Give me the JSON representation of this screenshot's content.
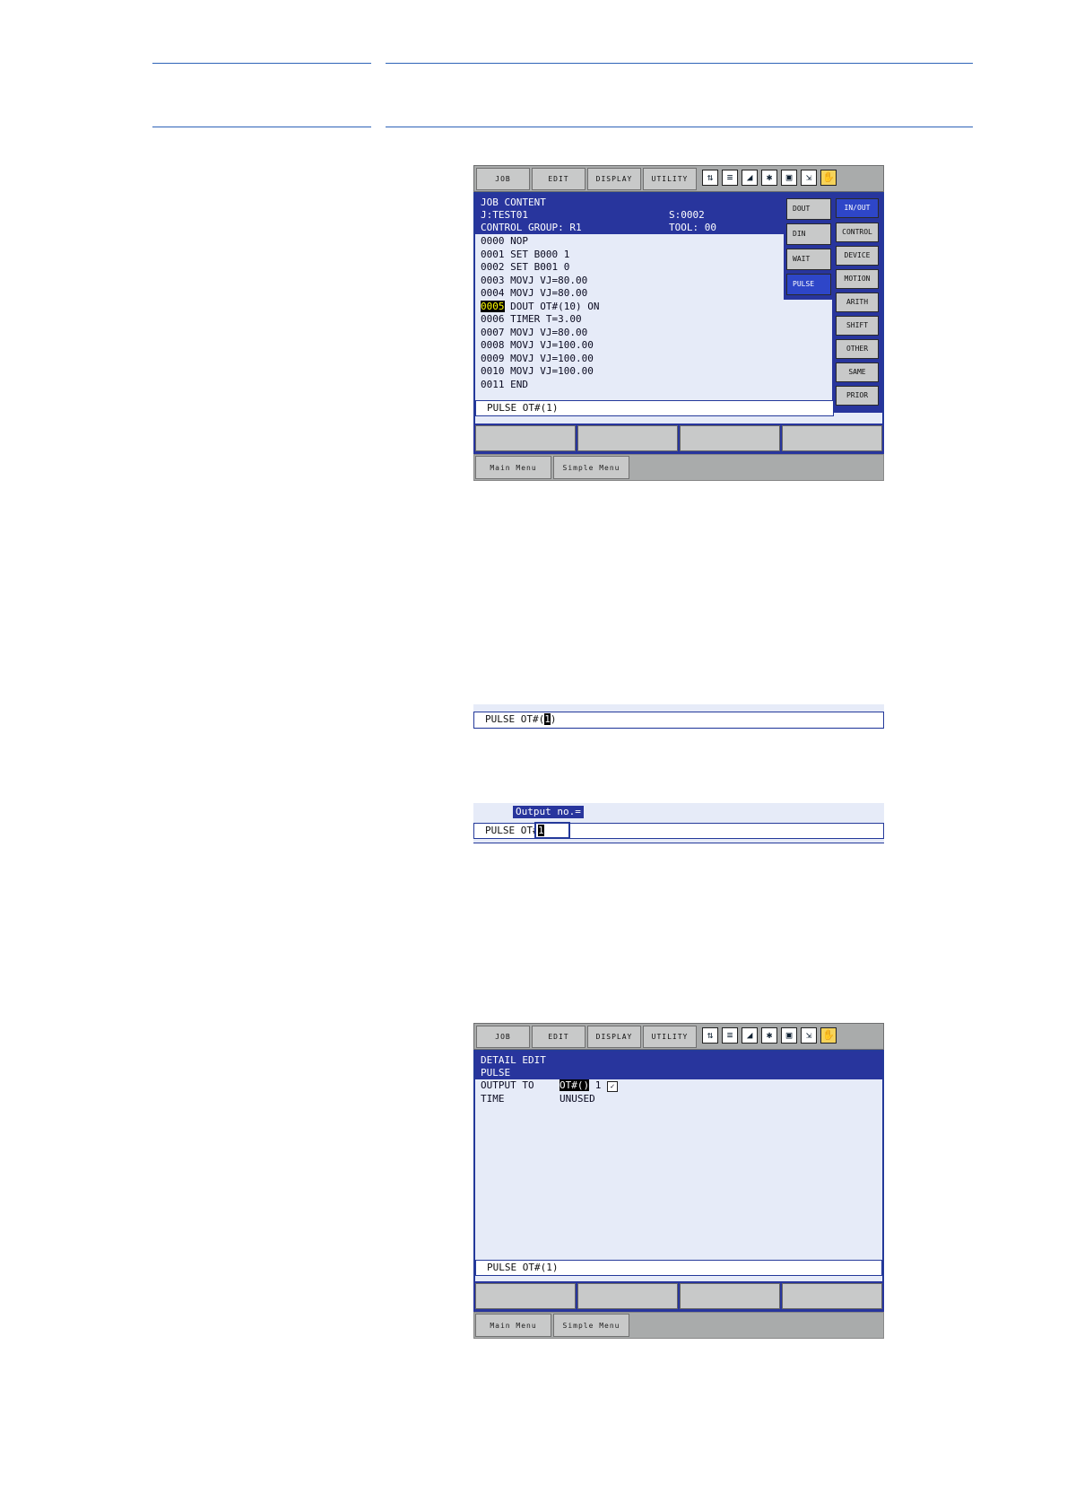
{
  "menu": {
    "job": "JOB",
    "edit": "EDIT",
    "display": "DISPLAY",
    "utility": "UTILITY"
  },
  "status_icons": [
    "hold-icon",
    "teach-icon",
    "signal-icon",
    "robot-icon",
    "page-icon",
    "storage-icon",
    "hand-icon"
  ],
  "bottom_menu": {
    "main": "Main Menu",
    "simple": "Simple Menu"
  },
  "screen1": {
    "title": "JOB CONTENT",
    "job": "J:TEST01",
    "step": "S:0002",
    "group": "CONTROL GROUP: R1",
    "tool": "TOOL: 00",
    "lines": [
      {
        "no": "0000",
        "text": "NOP"
      },
      {
        "no": "0001",
        "text": "SET B000 1"
      },
      {
        "no": "0002",
        "text": "SET B001 0"
      },
      {
        "no": "0003",
        "text": "MOVJ VJ=80.00"
      },
      {
        "no": "0004",
        "text": "MOVJ VJ=80.00"
      },
      {
        "no": "0005",
        "text": "DOUT OT#(10) ON",
        "cursor": true
      },
      {
        "no": "0006",
        "text": "TIMER T=3.00"
      },
      {
        "no": "0007",
        "text": "MOVJ VJ=80.00"
      },
      {
        "no": "0008",
        "text": "MOVJ VJ=100.00"
      },
      {
        "no": "0009",
        "text": "MOVJ VJ=100.00"
      },
      {
        "no": "0010",
        "text": "MOVJ VJ=100.00"
      },
      {
        "no": "0011",
        "text": "END"
      }
    ],
    "input_line": "PULSE OT#(1)",
    "sub_menu": [
      "DOUT",
      "DIN",
      "WAIT",
      "PULSE"
    ],
    "inst_menu": [
      "IN/OUT",
      "CONTROL",
      "DEVICE",
      "MOTION",
      "ARITH",
      "SHIFT",
      "OTHER",
      "SAME",
      "PRIOR"
    ]
  },
  "screen2": {
    "input_prefix": "PULSE OT#(",
    "cursor_char": "1",
    "input_suffix": ")"
  },
  "screen3": {
    "prompt": "Output no.=",
    "input_prefix": "PULSE OT#",
    "value": "1"
  },
  "screen4": {
    "title": "DETAIL EDIT",
    "sub": "PULSE",
    "rows": [
      {
        "label": "OUTPUT TO",
        "value": "OT#()",
        "extra": "1"
      },
      {
        "label": "TIME",
        "value": "UNUSED"
      }
    ],
    "input_line": "PULSE OT#(1)"
  },
  "colors": {
    "accent": "#28359d",
    "screen_bg": "#e6ebf8",
    "rule": "#2d63b8",
    "highlight": "#000000"
  }
}
